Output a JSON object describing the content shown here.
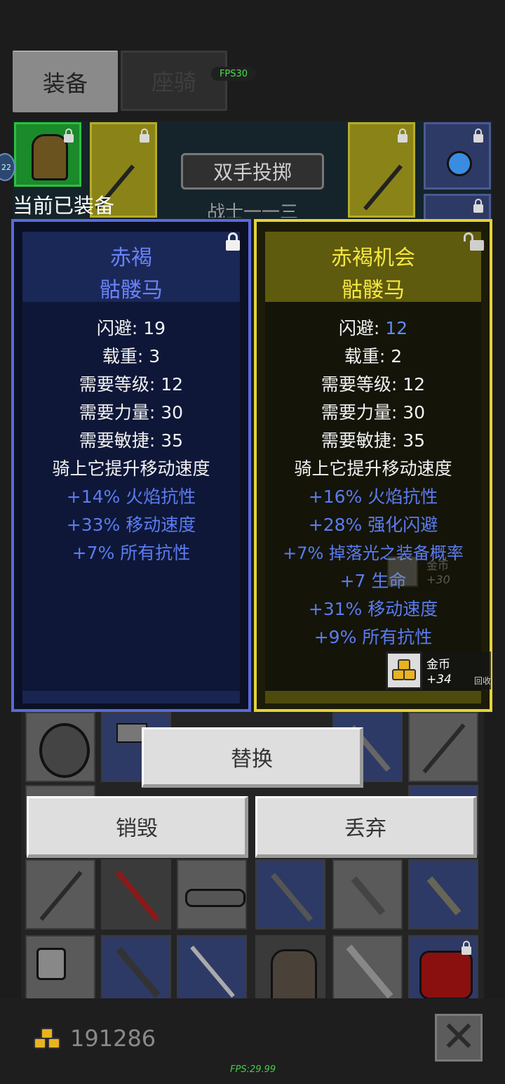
{
  "tabs": {
    "equipment": "装备",
    "mount": "座骑"
  },
  "fps_badge": "FPS30",
  "banner": {
    "title": "双手投掷",
    "subtitle": "战士一一三"
  },
  "player_badge": "22",
  "section_label": "当前已装备",
  "left_card": {
    "name": "赤褐",
    "type": "骷髅马",
    "stats": [
      "闪避: 19",
      "载重: 3",
      "需要等级: 12",
      "需要力量: 30",
      "需要敏捷: 35",
      "骑上它提升移动速度"
    ],
    "bonuses": [
      "+14% 火焰抗性",
      "+33% 移动速度",
      "+7% 所有抗性"
    ],
    "locked": true
  },
  "right_card": {
    "name": "赤褐机会",
    "type": "骷髅马",
    "dodge_label": "闪避: ",
    "dodge_value": "12",
    "stats": [
      "载重: 2",
      "需要等级: 12",
      "需要力量: 30",
      "需要敏捷: 35",
      "骑上它提升移动速度"
    ],
    "bonuses": [
      "+16% 火焰抗性",
      "+28% 强化闪避",
      "+7% 掉落光之装备概率",
      "+7 生命",
      "+31% 移动速度",
      "+9% 所有抗性"
    ],
    "locked": false
  },
  "ghost_coin": {
    "label": "金币",
    "value": "+30"
  },
  "coin_popup": {
    "label": "金币",
    "value": "+34",
    "action": "回收"
  },
  "buttons": {
    "replace": "替换",
    "destroy": "销毁",
    "discard": "丢弃"
  },
  "gold_total": "191286",
  "fps_footer": "FPS:29.99",
  "colors": {
    "rare_blue": "#5a6ad8",
    "unique_gold": "#e3d33a",
    "bonus_text": "#5a7cf0",
    "fps_green": "#45e04d"
  }
}
